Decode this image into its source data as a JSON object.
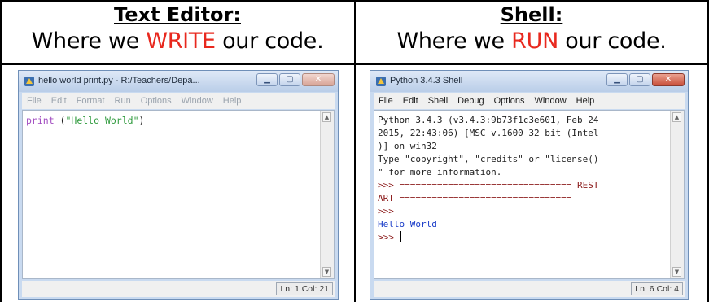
{
  "left": {
    "heading": "Text Editor:",
    "subtitle_before": "Where we ",
    "subtitle_highlight": "WRITE",
    "subtitle_after": " our code.",
    "window": {
      "title": "hello world print.py - R:/Teachers/Depa...",
      "menu": [
        "File",
        "Edit",
        "Format",
        "Run",
        "Options",
        "Window",
        "Help"
      ],
      "code": {
        "keyword": "print",
        "rest_before": " (",
        "string": "\"Hello World\"",
        "rest_after": ")"
      },
      "status": "Ln: 1 Col: 21"
    }
  },
  "right": {
    "heading": "Shell:",
    "subtitle_before": "Where we ",
    "subtitle_highlight": "RUN",
    "subtitle_after": " our code.",
    "window": {
      "title": "Python 3.4.3 Shell",
      "menu": [
        "File",
        "Edit",
        "Shell",
        "Debug",
        "Options",
        "Window",
        "Help"
      ],
      "lines": {
        "l1": "Python 3.4.3 (v3.4.3:9b73f1c3e601, Feb 24",
        "l2": "2015, 22:43:06) [MSC v.1600 32 bit (Intel",
        "l3": ")] on win32",
        "l4": "Type \"copyright\", \"credits\" or \"license()",
        "l5": "\" for more information.",
        "l6_prompt": ">>> ",
        "l6_rest": "================================ REST",
        "l7": "ART ================================",
        "l8_prompt": ">>>",
        "l9_out": "Hello World",
        "l10_prompt": ">>> "
      },
      "status": "Ln: 6 Col: 4"
    }
  },
  "colors": {
    "highlight": "#e8281e",
    "keyword": "#a14cc0",
    "string": "#2e9a3c",
    "output": "#1a3cc8",
    "prompt": "#8b1a1a"
  }
}
